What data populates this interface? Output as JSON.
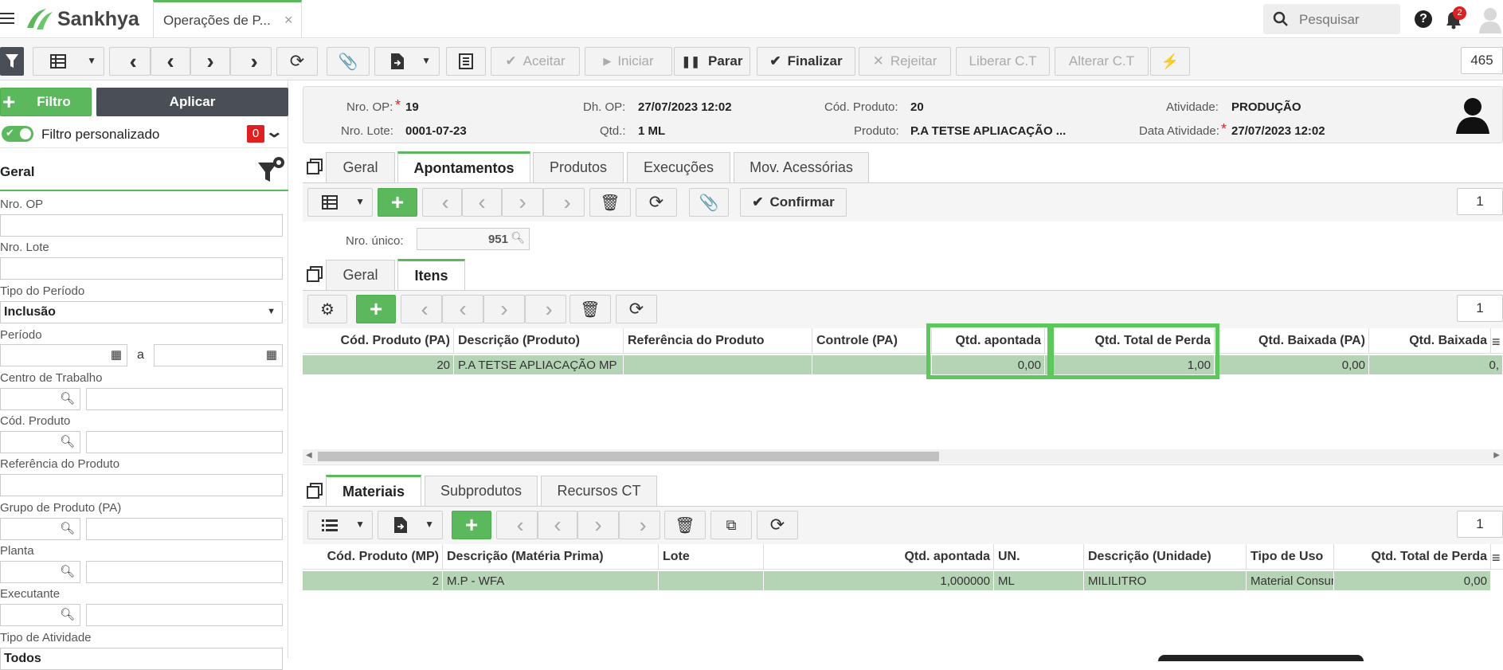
{
  "app": {
    "brand": "Sankhya",
    "tab_title": "Operações de P...",
    "search_placeholder": "Pesquisar",
    "notif_count": "2"
  },
  "toolbar": {
    "aceitar": "Aceitar",
    "iniciar": "Iniciar",
    "parar": "Parar",
    "finalizar": "Finalizar",
    "rejeitar": "Rejeitar",
    "liberar": "Liberar C.T",
    "alterar": "Alterar C.T",
    "counter": "465"
  },
  "sidebar": {
    "filtro_label": "Filtro",
    "aplicar_label": "Aplicar",
    "custom_filter_label": "Filtro personalizado",
    "custom_filter_count": "0",
    "section_title": "Geral",
    "fields": {
      "nro_op": "Nro. OP",
      "nro_lote": "Nro. Lote",
      "tipo_periodo": "Tipo do Período",
      "tipo_periodo_value": "Inclusão",
      "periodo": "Período",
      "periodo_sep": "a",
      "centro_trabalho": "Centro de Trabalho",
      "cod_produto": "Cód. Produto",
      "ref_produto": "Referência do Produto",
      "grupo_produto": "Grupo de Produto (PA)",
      "planta": "Planta",
      "executante": "Executante",
      "tipo_atividade": "Tipo de Atividade",
      "tipo_atividade_value": "Todos"
    }
  },
  "header": {
    "nro_op_label": "Nro. OP:",
    "nro_op": "19",
    "dh_op_label": "Dh. OP:",
    "dh_op": "27/07/2023 12:02",
    "cod_produto_label": "Cód. Produto:",
    "cod_produto": "20",
    "atividade_label": "Atividade:",
    "atividade": "PRODUÇÃO",
    "nro_lote_label": "Nro. Lote:",
    "nro_lote": "0001-07-23",
    "qtd_label": "Qtd.:",
    "qtd": "1 ML",
    "produto_label": "Produto:",
    "produto": "P.A TETSE APLIACAÇÃO ...",
    "data_atividade_label": "Data Atividade:",
    "data_atividade": "27/07/2023 12:02"
  },
  "main_tabs": [
    "Geral",
    "Apontamentos",
    "Produtos",
    "Execuções",
    "Mov. Acessórias"
  ],
  "apont": {
    "confirmar": "Confirmar",
    "counter": "1",
    "nro_unico_label": "Nro. único:",
    "nro_unico": "951"
  },
  "sub_tabs": [
    "Geral",
    "Itens"
  ],
  "itens": {
    "counter": "1",
    "columns": [
      "Cód. Produto (PA)",
      "Descrição (Produto)",
      "Referência do Produto",
      "Controle (PA)",
      "Qtd. apontada",
      "Qtd. Total de Perda",
      "Qtd. Baixada (PA)",
      "Qtd. Baixada"
    ],
    "row": [
      "20",
      "P.A TETSE APLIACAÇÃO MP",
      "",
      "",
      "0,00",
      "1,00",
      "0,00",
      "0,"
    ]
  },
  "bottom_tabs": [
    "Materiais",
    "Subprodutos",
    "Recursos CT"
  ],
  "materiais": {
    "counter": "1",
    "columns": [
      "Cód. Produto (MP)",
      "Descrição (Matéria Prima)",
      "Lote",
      "Qtd. apontada",
      "UN.",
      "Descrição (Unidade)",
      "Tipo de Uso",
      "Qtd. Total de Perda"
    ],
    "row": [
      "2",
      "M.P - WFA",
      "",
      "1,000000",
      "ML",
      "MILILITRO",
      "Material Consur",
      "0,00"
    ]
  },
  "colors": {
    "accent": "#5cb85c",
    "dark_button": "#4a4f57",
    "row_selected": "#b5d4b5",
    "badge_red": "#e02020"
  }
}
